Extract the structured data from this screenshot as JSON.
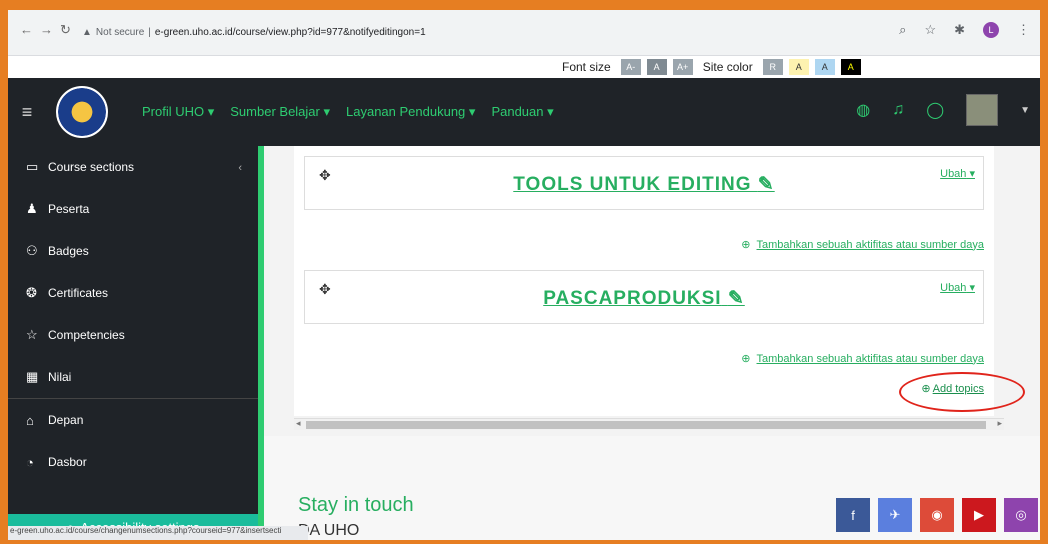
{
  "browser": {
    "security_label": "Not secure",
    "url": "e-green.uho.ac.id/course/view.php?id=977&notifyeditingon=1",
    "profile_initial": "L"
  },
  "accessibility_bar": {
    "font_size_label": "Font size",
    "font_buttons": [
      "A-",
      "A",
      "A+"
    ],
    "site_color_label": "Site color",
    "color_buttons": [
      "R",
      "A",
      "A",
      "A"
    ]
  },
  "navbar": {
    "menu": [
      {
        "label": "Profil UHO"
      },
      {
        "label": "Sumber Belajar"
      },
      {
        "label": "Layanan Pendukung"
      },
      {
        "label": "Panduan"
      }
    ]
  },
  "sidebar": {
    "items": [
      {
        "label": "Course sections",
        "icon": "folder-icon"
      },
      {
        "label": "Peserta",
        "icon": "users-icon"
      },
      {
        "label": "Badges",
        "icon": "badge-icon"
      },
      {
        "label": "Certificates",
        "icon": "certificate-icon"
      },
      {
        "label": "Competencies",
        "icon": "star-icon"
      },
      {
        "label": "Nilai",
        "icon": "grades-icon"
      },
      {
        "label": "Depan",
        "icon": "home-icon"
      },
      {
        "label": "Dasbor",
        "icon": "dashboard-icon"
      }
    ],
    "accessibility_settings": "Accessibility settings"
  },
  "sections": [
    {
      "title": "TOOLS UNTUK EDITING",
      "edit_link": "Ubah",
      "add_activity": "Tambahkan sebuah aktifitas atau sumber daya"
    },
    {
      "title": "PASCAPRODUKSI",
      "edit_link": "Ubah",
      "add_activity": "Tambahkan sebuah aktifitas atau sumber daya"
    }
  ],
  "add_topics": "Add topics",
  "footer": {
    "heading": "Stay in touch",
    "subtitle": "DA UHO"
  },
  "status_bar_url": "e-green.uho.ac.id/course/changenumsections.php?courseid=977&insertsecti"
}
